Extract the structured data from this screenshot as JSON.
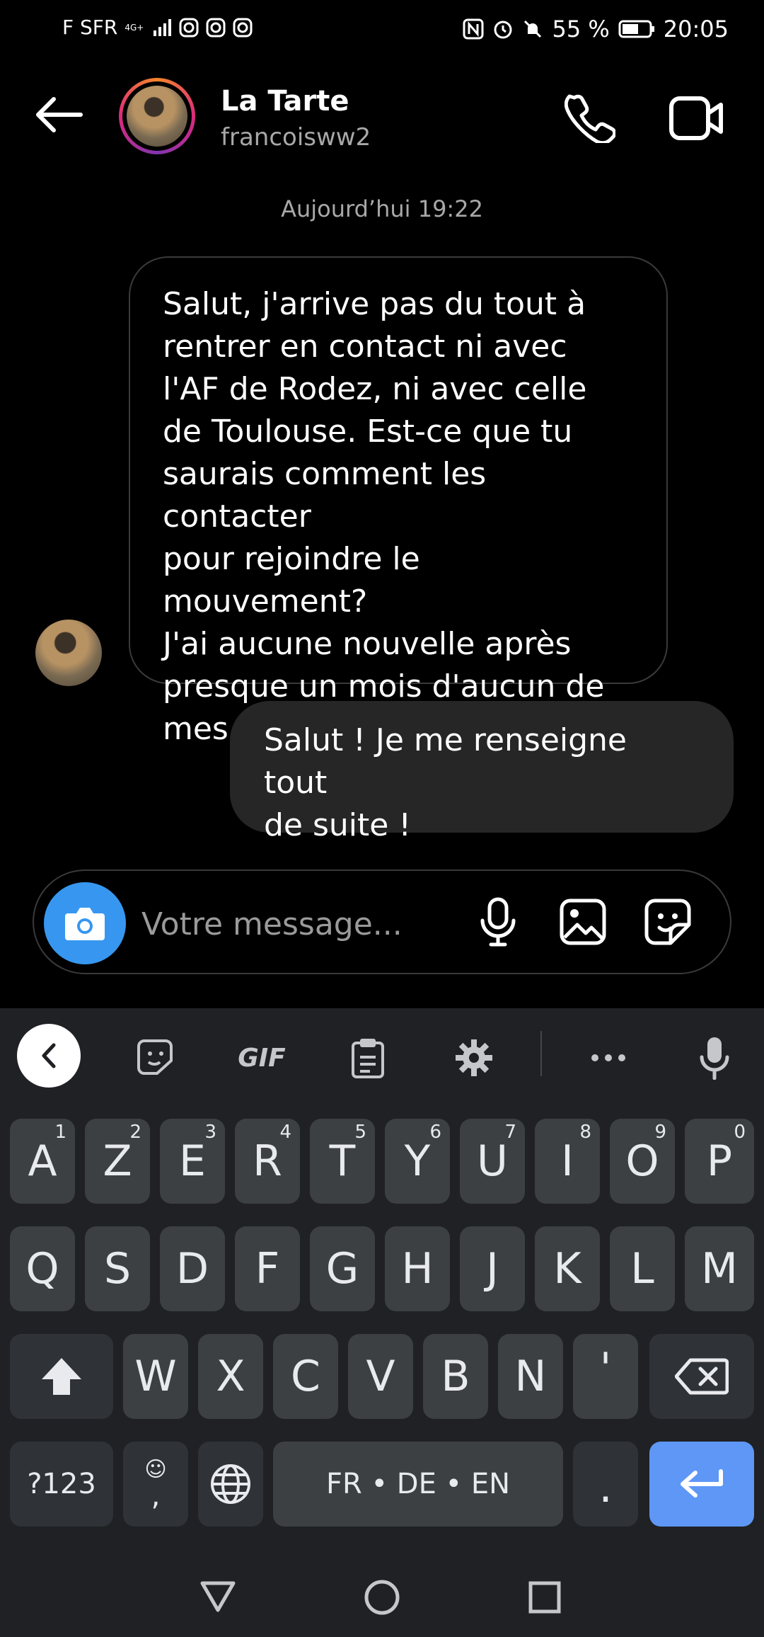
{
  "status_bar": {
    "carrier": "F SFR",
    "network": "4G+",
    "battery": "55 %",
    "time": "20:05"
  },
  "header": {
    "name": "La Tarte",
    "username": "francoisww2"
  },
  "timestamp": "Aujourd’hui 19:22",
  "messages": {
    "incoming": [
      "Salut, j'arrive pas du tout à",
      "rentrer en contact ni avec",
      "l'AF de Rodez, ni avec celle",
      "de Toulouse. Est-ce que tu",
      "saurais comment les contacter",
      "pour rejoindre le mouvement?",
      "J'ai aucune nouvelle après",
      "presque un mois d'aucun de",
      "mes contacts"
    ],
    "outgoing": [
      "Salut ! Je me renseigne tout",
      "de suite !"
    ]
  },
  "composer": {
    "placeholder": "Votre message..."
  },
  "keyboard": {
    "toolbar_gif": "GIF",
    "row1": [
      {
        "k": "A",
        "n": "1"
      },
      {
        "k": "Z",
        "n": "2"
      },
      {
        "k": "E",
        "n": "3"
      },
      {
        "k": "R",
        "n": "4"
      },
      {
        "k": "T",
        "n": "5"
      },
      {
        "k": "Y",
        "n": "6"
      },
      {
        "k": "U",
        "n": "7"
      },
      {
        "k": "I",
        "n": "8"
      },
      {
        "k": "O",
        "n": "9"
      },
      {
        "k": "P",
        "n": "0"
      }
    ],
    "row2": [
      "Q",
      "S",
      "D",
      "F",
      "G",
      "H",
      "J",
      "K",
      "L",
      "M"
    ],
    "row3": [
      "W",
      "X",
      "C",
      "V",
      "B",
      "N",
      "'"
    ],
    "symbols": "?123",
    "emoji_comma": ",",
    "space": "FR • DE • EN",
    "period": "."
  }
}
